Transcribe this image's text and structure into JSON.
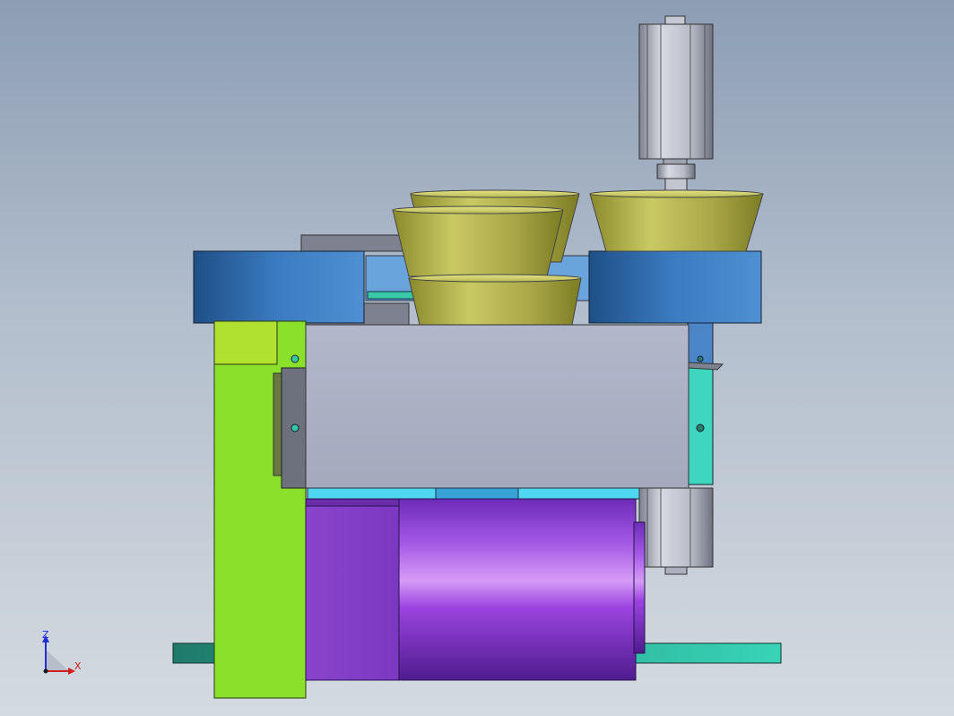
{
  "viewport": {
    "background_top": "#8d9db4",
    "background_bottom": "#d4dae1"
  },
  "triad": {
    "z_label": "Z",
    "x_label": "X",
    "z_color": "#1f2fd0",
    "x_color": "#d01f1f"
  },
  "parts": {
    "cups": {
      "color": "#b9b94a"
    },
    "rings": {
      "color": "#3f7fc0"
    },
    "side_plate": {
      "color": "#8fdf2a"
    },
    "housing": {
      "color": "#a9afc4"
    },
    "motor": {
      "color": "#9b3fe0"
    },
    "bracket": {
      "color": "#3fd6c0"
    },
    "base_rail": {
      "color": "#2fb59a"
    },
    "cylinder": {
      "color": "#b8bcc8"
    }
  }
}
